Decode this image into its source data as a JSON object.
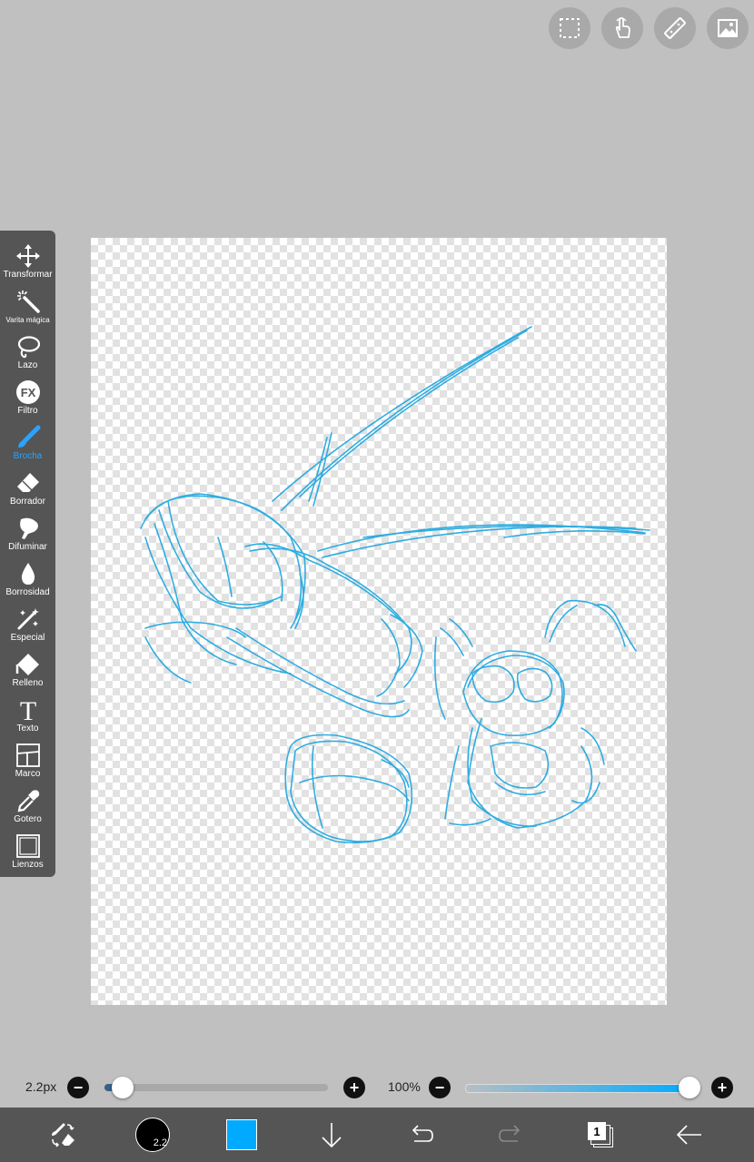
{
  "tools": [
    {
      "id": "transform",
      "label": "Transformar",
      "icon": "move-arrows-icon",
      "active": false
    },
    {
      "id": "magic-wand",
      "label": "Varita mágica",
      "icon": "magic-wand-icon",
      "active": false
    },
    {
      "id": "lasso",
      "label": "Lazo",
      "icon": "lasso-icon",
      "active": false
    },
    {
      "id": "filter",
      "label": "Filtro",
      "icon": "fx-icon",
      "active": false
    },
    {
      "id": "brush",
      "label": "Brocha",
      "icon": "brush-icon",
      "active": true
    },
    {
      "id": "eraser",
      "label": "Borrador",
      "icon": "eraser-icon",
      "active": false
    },
    {
      "id": "smudge",
      "label": "Difuminar",
      "icon": "smudge-icon",
      "active": false
    },
    {
      "id": "blur",
      "label": "Borrosidad",
      "icon": "droplet-icon",
      "active": false
    },
    {
      "id": "special",
      "label": "Especial",
      "icon": "sparkle-pen-icon",
      "active": false
    },
    {
      "id": "fill",
      "label": "Relleno",
      "icon": "fill-bucket-icon",
      "active": false
    },
    {
      "id": "text",
      "label": "Texto",
      "icon": "text-icon",
      "active": false
    },
    {
      "id": "frame",
      "label": "Marco",
      "icon": "frame-icon",
      "active": false
    },
    {
      "id": "eyedropper",
      "label": "Gotero",
      "icon": "eyedropper-icon",
      "active": false
    },
    {
      "id": "canvas",
      "label": "Lienzos",
      "icon": "canvas-icon",
      "active": false
    }
  ],
  "fx_glyph": "FX",
  "text_glyph": "T",
  "top_buttons": [
    "selection-icon",
    "hand-icon",
    "ruler-icon",
    "image-icon"
  ],
  "brush_size": {
    "label": "2.2px",
    "value": 2.2,
    "badge": "2.2",
    "minus": "−",
    "plus": "+"
  },
  "opacity": {
    "label": "100%",
    "value": 100,
    "minus": "−",
    "plus": "+"
  },
  "layer_count": "1",
  "colors": {
    "accent": "#2aa3ff",
    "stroke": "#1aa6e0",
    "current_color": "#00aaff",
    "toolbar": "#555555",
    "background": "#c0c0c0"
  }
}
